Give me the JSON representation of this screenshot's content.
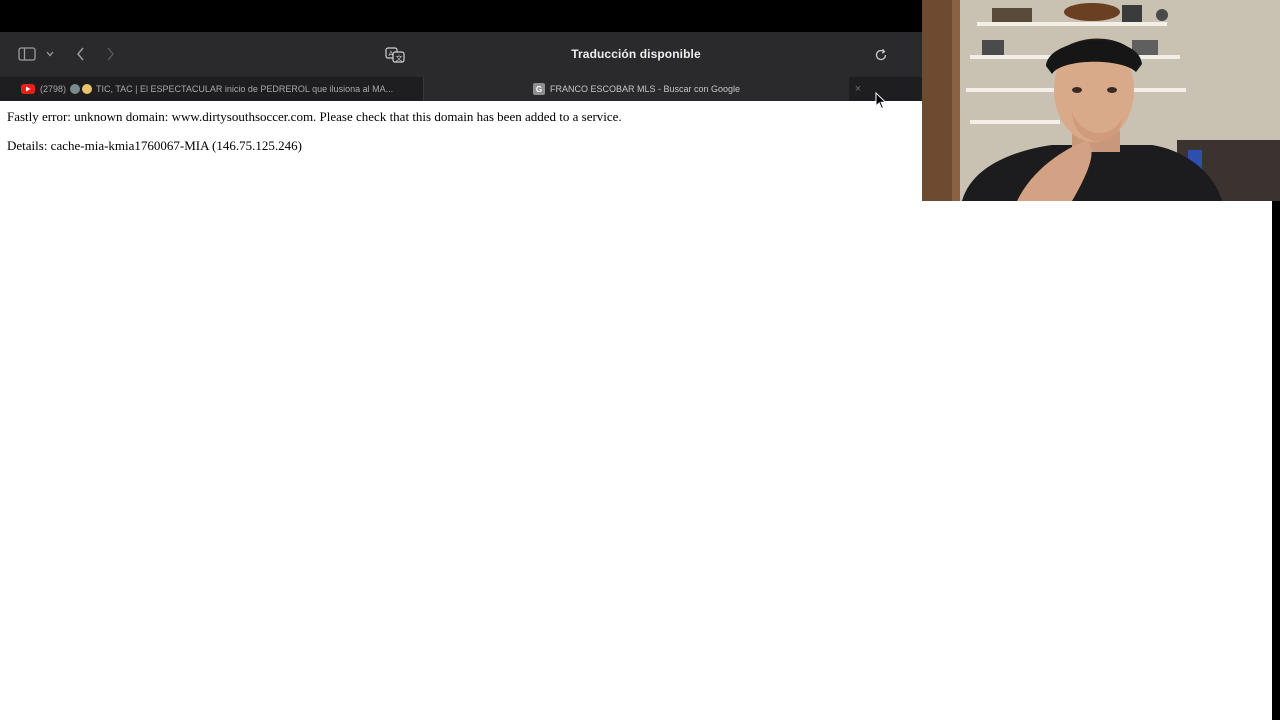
{
  "browser": {
    "address_bar": {
      "text": "Traducción disponible"
    },
    "tabs": [
      {
        "label_prefix": "(2798)",
        "label": "TIC, TAC | El ESPECTACULAR inicio de PEDREROL que ilusiona al MA...",
        "favicon": "youtube-icon",
        "active": false
      },
      {
        "label": "FRANCO ESCOBAR MLS - Buscar con Google",
        "favicon": "google-icon",
        "favicon_letter": "G",
        "active": true
      }
    ],
    "close_glyph": "×"
  },
  "page": {
    "error_line": "Fastly error: unknown domain: www.dirtysouthsoccer.com. Please check that this domain has been added to a service.",
    "details_line": "Details: cache-mia-kmia1760067-MIA (146.75.125.246)"
  },
  "colors": {
    "toolbar_bg": "#2a2a2c",
    "tabbar_bg": "#1e1e20",
    "active_tab_bg": "#2a2a2c",
    "youtube_red": "#e62117"
  }
}
